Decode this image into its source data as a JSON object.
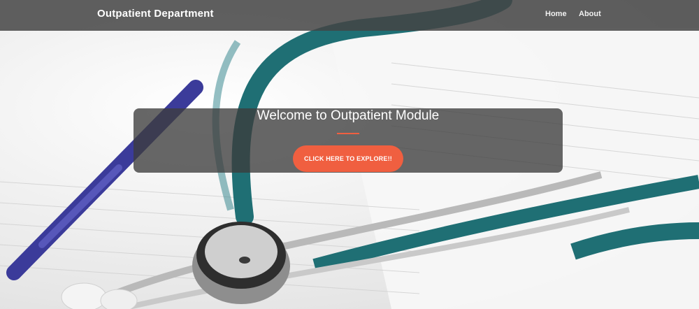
{
  "navbar": {
    "brand": "Outpatient Department",
    "links": [
      {
        "label": "Home"
      },
      {
        "label": "About"
      }
    ]
  },
  "hero": {
    "title": "Welcome to Outpatient Module",
    "cta_label": "CLICK HERE TO EXPLORE!!"
  },
  "colors": {
    "navbar_bg": "#444444",
    "accent": "#f05f40",
    "panel_bg": "#3c3c3c"
  }
}
